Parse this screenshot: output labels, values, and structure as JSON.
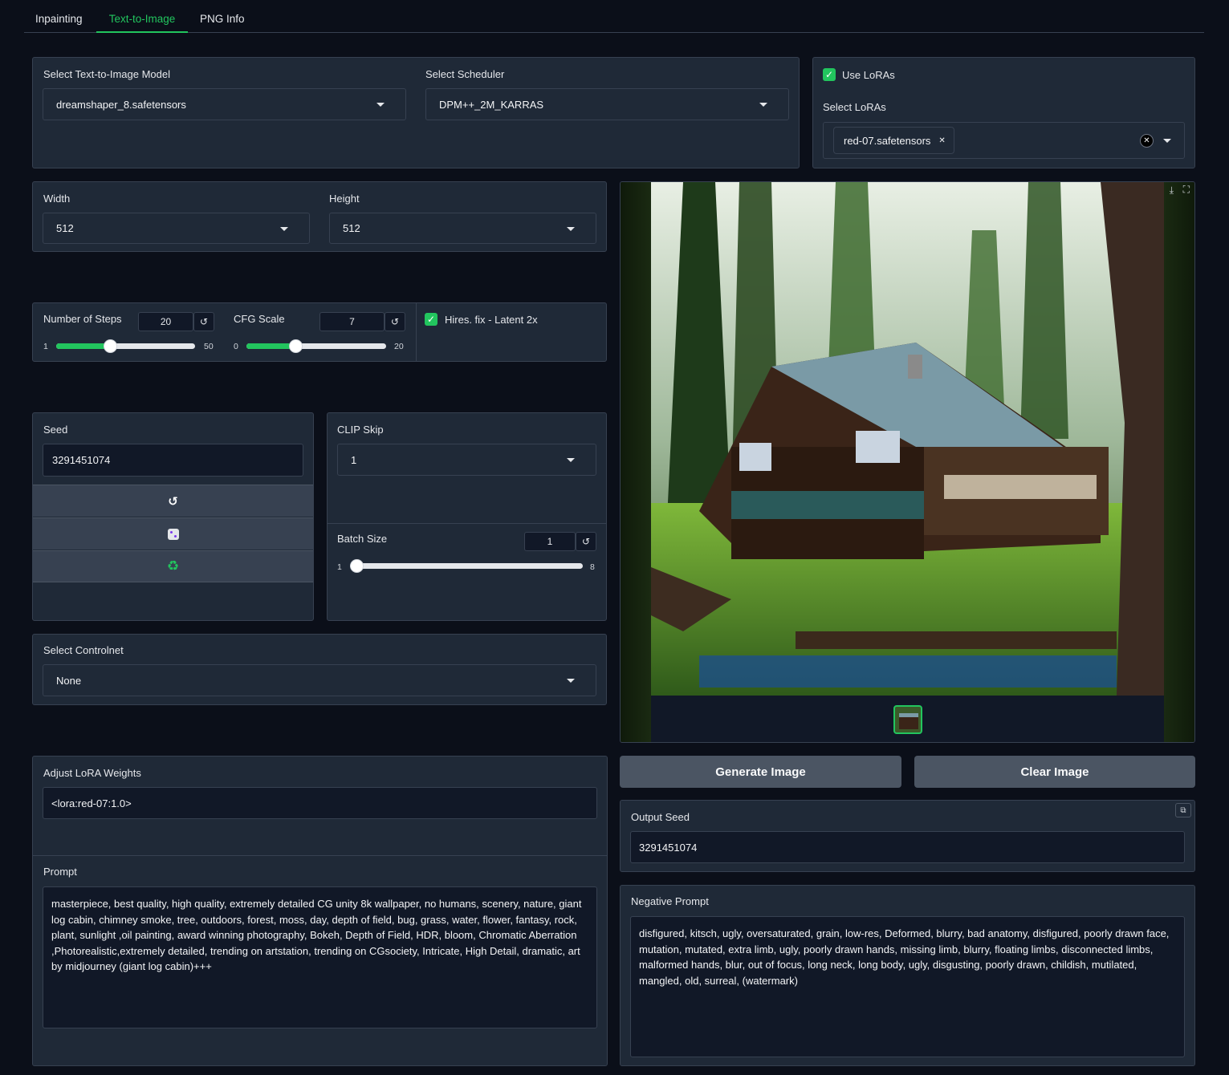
{
  "tabs": [
    {
      "label": "Inpainting",
      "active": false
    },
    {
      "label": "Text-to-Image",
      "active": true
    },
    {
      "label": "PNG Info",
      "active": false
    }
  ],
  "model": {
    "label": "Select Text-to-Image Model",
    "value": "dreamshaper_8.safetensors"
  },
  "scheduler": {
    "label": "Select Scheduler",
    "value": "DPM++_2M_KARRAS"
  },
  "loras": {
    "use_label": "Use LoRAs",
    "use_checked": true,
    "select_label": "Select LoRAs",
    "chips": [
      "red-07.safetensors"
    ]
  },
  "width": {
    "label": "Width",
    "value": "512"
  },
  "height": {
    "label": "Height",
    "value": "512"
  },
  "steps": {
    "label": "Number of Steps",
    "value": "20",
    "min": "1",
    "max": "50",
    "fraction": 0.388
  },
  "cfg": {
    "label": "CFG Scale",
    "value": "7",
    "min": "0",
    "max": "20",
    "fraction": 0.35
  },
  "hires": {
    "label": "Hires. fix - Latent 2x",
    "checked": true
  },
  "seed": {
    "label": "Seed",
    "value": "3291451074",
    "buttons": [
      "reset-icon",
      "dice-icon",
      "recycle-icon"
    ]
  },
  "clip_skip": {
    "label": "CLIP Skip",
    "value": "1"
  },
  "batch": {
    "label": "Batch Size",
    "value": "1",
    "min": "1",
    "max": "8",
    "fraction": 0.0
  },
  "controlnet": {
    "label": "Select Controlnet",
    "value": "None"
  },
  "lora_weights": {
    "label": "Adjust LoRA Weights",
    "value": "<lora:red-07:1.0>"
  },
  "prompt": {
    "label": "Prompt",
    "value": "masterpiece, best quality, high quality, extremely detailed CG unity 8k wallpaper, no humans, scenery, nature, giant log cabin, chimney smoke, tree, outdoors, forest, moss, day, depth of field, bug, grass, water, flower, fantasy, rock, plant, sunlight ,oil painting, award winning photography, Bokeh, Depth of Field, HDR, bloom, Chromatic Aberration ,Photorealistic,extremely detailed, trending on artstation, trending on CGsociety, Intricate, High Detail, dramatic, art by midjourney (giant log cabin)+++"
  },
  "actions": {
    "generate": "Generate Image",
    "clear": "Clear Image"
  },
  "output_seed": {
    "label": "Output Seed",
    "value": "3291451074"
  },
  "negative_prompt": {
    "label": "Negative Prompt",
    "value": "disfigured, kitsch, ugly, oversaturated, grain, low-res, Deformed, blurry, bad anatomy, disfigured, poorly drawn face, mutation, mutated, extra limb, ugly, poorly drawn hands, missing limb, blurry, floating limbs, disconnected limbs, malformed hands, blur, out of focus, long neck, long body, ugly, disgusting, poorly drawn, childish, mutilated, mangled, old, surreal, (watermark)"
  },
  "colors": {
    "accent": "#22c55e",
    "background": "#0b0f19",
    "panel": "#1f2937",
    "button": "#4b5563"
  }
}
